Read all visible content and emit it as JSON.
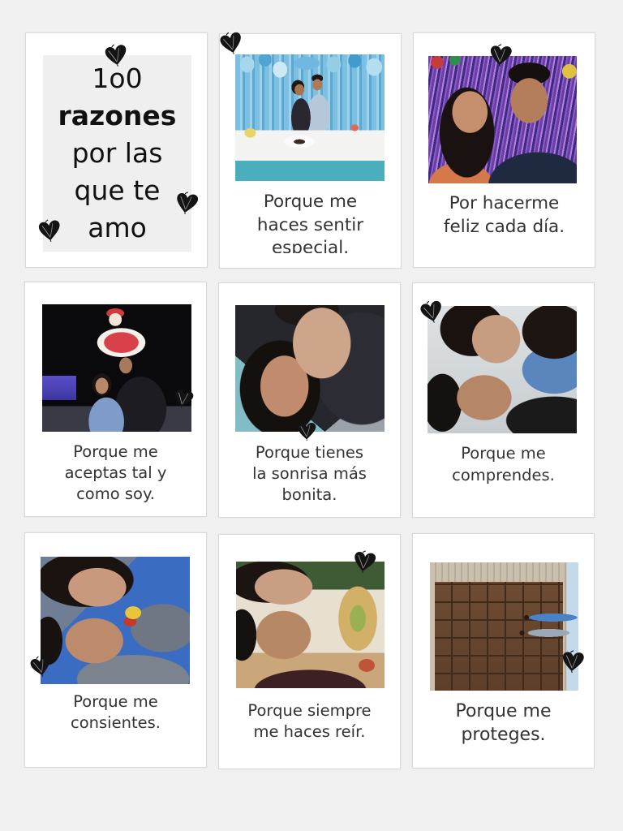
{
  "colors": {
    "page_background": "#f0f0f0",
    "card_background": "#ffffff",
    "title_box_background": "#efefef",
    "title_text": "#111111",
    "caption_text": "#333333",
    "heart_doodle": "#141414"
  },
  "icons": {
    "decoration": "heart-doodle-icon"
  },
  "title_card": {
    "lines": [
      "1o0",
      "razones",
      "por las",
      "que te",
      "amo"
    ]
  },
  "reasons": [
    {
      "lines": [
        "Porque me",
        "haces sentir",
        "especial."
      ]
    },
    {
      "lines": [
        "Por hacerme",
        "feliz cada día."
      ]
    },
    {
      "lines": [
        "Porque me",
        "aceptas tal y",
        "como soy."
      ]
    },
    {
      "lines": [
        "Porque tienes",
        "la sonrisa más",
        "bonita."
      ]
    },
    {
      "lines": [
        "Porque me",
        "comprendes."
      ]
    },
    {
      "lines": [
        "Porque me",
        "consientes."
      ]
    },
    {
      "lines": [
        "Porque siempre",
        "me haces reír."
      ]
    },
    {
      "lines": [
        "Porque me",
        "proteges."
      ]
    }
  ]
}
